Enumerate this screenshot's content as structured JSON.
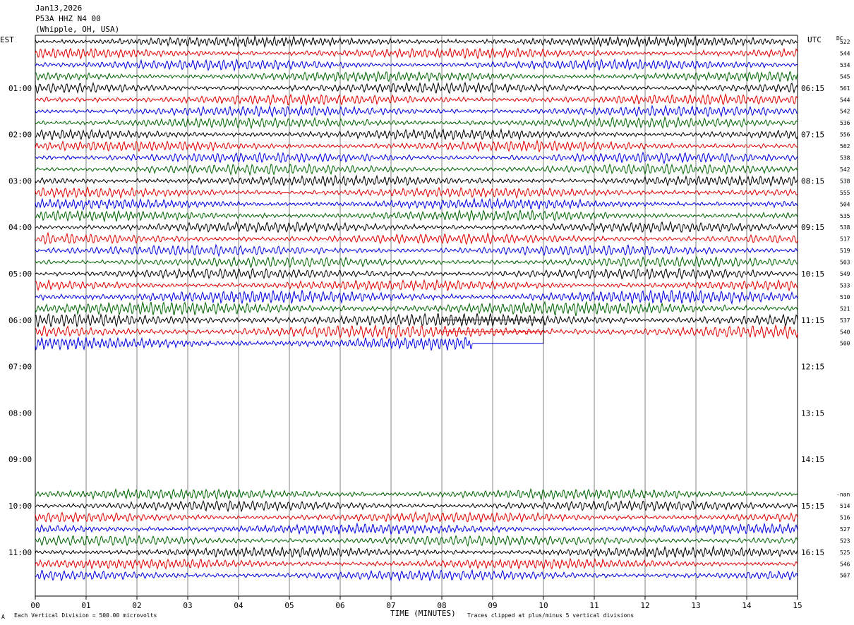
{
  "header": {
    "date": "Jan13,2026",
    "station": "P53A HHZ N4 00",
    "location": "(Whipple, OH, USA)"
  },
  "axis_labels": {
    "left_zone": "EST",
    "right_zone": "UTC",
    "dc_label": "DC",
    "x_title": "TIME (MINUTES)"
  },
  "footer": {
    "scale_note": "Each Vertical Division =  500.00 microvolts",
    "clip_note": "Traces clipped at plus/minus 5 vertical divisions",
    "corner_mark": "A"
  },
  "colors": {
    "cycle": [
      "#000000",
      "#e00000",
      "#0000e0",
      "#006400"
    ],
    "grid": "#808080"
  },
  "chart_data": {
    "type": "line",
    "subtype": "helicorder",
    "x_ticks": [
      "00",
      "01",
      "02",
      "03",
      "04",
      "05",
      "06",
      "07",
      "08",
      "09",
      "10",
      "11",
      "12",
      "13",
      "14",
      "15"
    ],
    "x_range_minutes": [
      0,
      15
    ],
    "rows_per_hour": 4,
    "est_hour_labels": [
      "01:00",
      "02:00",
      "03:00",
      "04:00",
      "05:00",
      "06:00",
      "07:00",
      "08:00",
      "09:00",
      "10:00",
      "11:00"
    ],
    "utc_hour_labels": [
      "06:15",
      "07:15",
      "08:15",
      "09:15",
      "10:15",
      "11:15",
      "12:15",
      "13:15",
      "14:15",
      "15:15",
      "16:15"
    ],
    "total_rows": 48,
    "first_row_hour_est": "00:00",
    "traces_block_1": {
      "start_row": 0,
      "dc_values": [
        "522",
        "544",
        "534",
        "545",
        "561",
        "544",
        "542",
        "536",
        "556",
        "562",
        "538",
        "542",
        "538",
        "555",
        "504",
        "535",
        "538",
        "517",
        "519",
        "503",
        "549",
        "533",
        "510",
        "521",
        "537",
        "540",
        "500"
      ],
      "last_row_end_minute": 8.6,
      "gap_segment_minutes": [
        8.6,
        10.0
      ]
    },
    "traces_block_2": {
      "start_row": 40,
      "first_dc_label": "-nan",
      "dc_values": [
        "514",
        "516",
        "527",
        "523",
        "525",
        "546",
        "507"
      ]
    },
    "gridlines": "vertical at each minute"
  }
}
